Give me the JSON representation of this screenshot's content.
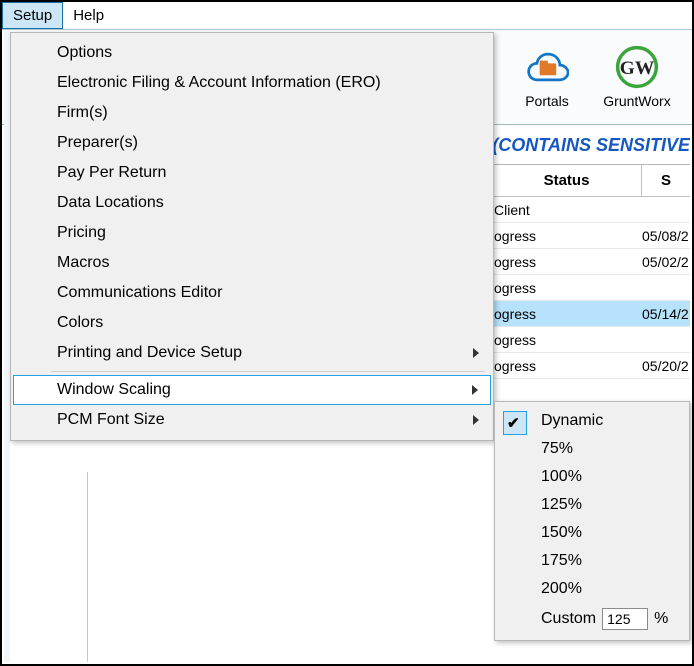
{
  "menubar": {
    "setup": "Setup",
    "help": "Help"
  },
  "toolbar": {
    "portals": "Portals",
    "gruntworx": "GruntWorx"
  },
  "banner": "(CONTAINS SENSITIVE",
  "grid": {
    "header_status": "Status",
    "header_s": "S",
    "rows": [
      {
        "status": "Client",
        "date": ""
      },
      {
        "status": "ogress",
        "date": "05/08/2"
      },
      {
        "status": "ogress",
        "date": "05/02/2"
      },
      {
        "status": "ogress",
        "date": ""
      },
      {
        "status": "ogress",
        "date": "05/14/2",
        "sel": true
      },
      {
        "status": "ogress",
        "date": ""
      },
      {
        "status": "ogress",
        "date": "05/20/2"
      }
    ]
  },
  "setup_menu": {
    "options": "Options",
    "ero": "Electronic Filing & Account Information (ERO)",
    "firms": "Firm(s)",
    "preparers": "Preparer(s)",
    "ppr": "Pay Per Return",
    "data_locations": "Data Locations",
    "pricing": "Pricing",
    "macros": "Macros",
    "comm_editor": "Communications Editor",
    "colors": "Colors",
    "printing": "Printing and Device Setup",
    "window_scaling": "Window Scaling",
    "pcm_font": "PCM Font Size"
  },
  "scaling_submenu": {
    "dynamic": "Dynamic",
    "p75": "75%",
    "p100": "100%",
    "p125": "125%",
    "p150": "150%",
    "p175": "175%",
    "p200": "200%",
    "custom": "Custom",
    "custom_value": "125",
    "percent": "%"
  },
  "checkmark": "✔"
}
